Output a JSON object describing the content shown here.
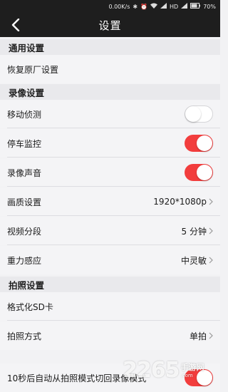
{
  "status_bar": {
    "network_speed": "0.00K/s",
    "bluetooth_icon": "bluetooth-icon",
    "alarm_icon": "alarm-icon",
    "wifi_icon": "wifi-icon",
    "signal_1": "signal-icon",
    "hd_label": "HD",
    "signal_2": "signal-icon",
    "battery_percent": "70%"
  },
  "nav": {
    "back_icon": "chevron-left-icon",
    "title": "设置"
  },
  "sections": {
    "general": {
      "title": "通用设置"
    },
    "recording": {
      "title": "录像设置"
    },
    "photo": {
      "title": "拍照设置"
    }
  },
  "items": {
    "restore_factory": {
      "label": "恢复原厂设置"
    },
    "motion_detect": {
      "label": "移动侦测",
      "enabled": false
    },
    "parking_monitor": {
      "label": "停车监控",
      "enabled": true
    },
    "record_audio": {
      "label": "录像声音",
      "enabled": true
    },
    "quality": {
      "label": "画质设置",
      "value": "1920*1080p"
    },
    "segment": {
      "label": "视频分段",
      "value": "5 分钟"
    },
    "gsensor": {
      "label": "重力感应",
      "value": "中灵敏"
    },
    "format_sd": {
      "label": "格式化SD卡"
    },
    "shoot_mode": {
      "label": "拍照方式",
      "value": "单拍"
    },
    "auto_switch": {
      "label": "10秒后自动从拍照模式切回录像模式",
      "enabled": true
    }
  },
  "colors": {
    "accent": "#f23d3d",
    "bar_bg": "#1e1e1e",
    "page_bg": "#f2f2f4"
  },
  "watermark": {
    "number": "2265",
    "cn": "手游网",
    "url": ".com"
  }
}
